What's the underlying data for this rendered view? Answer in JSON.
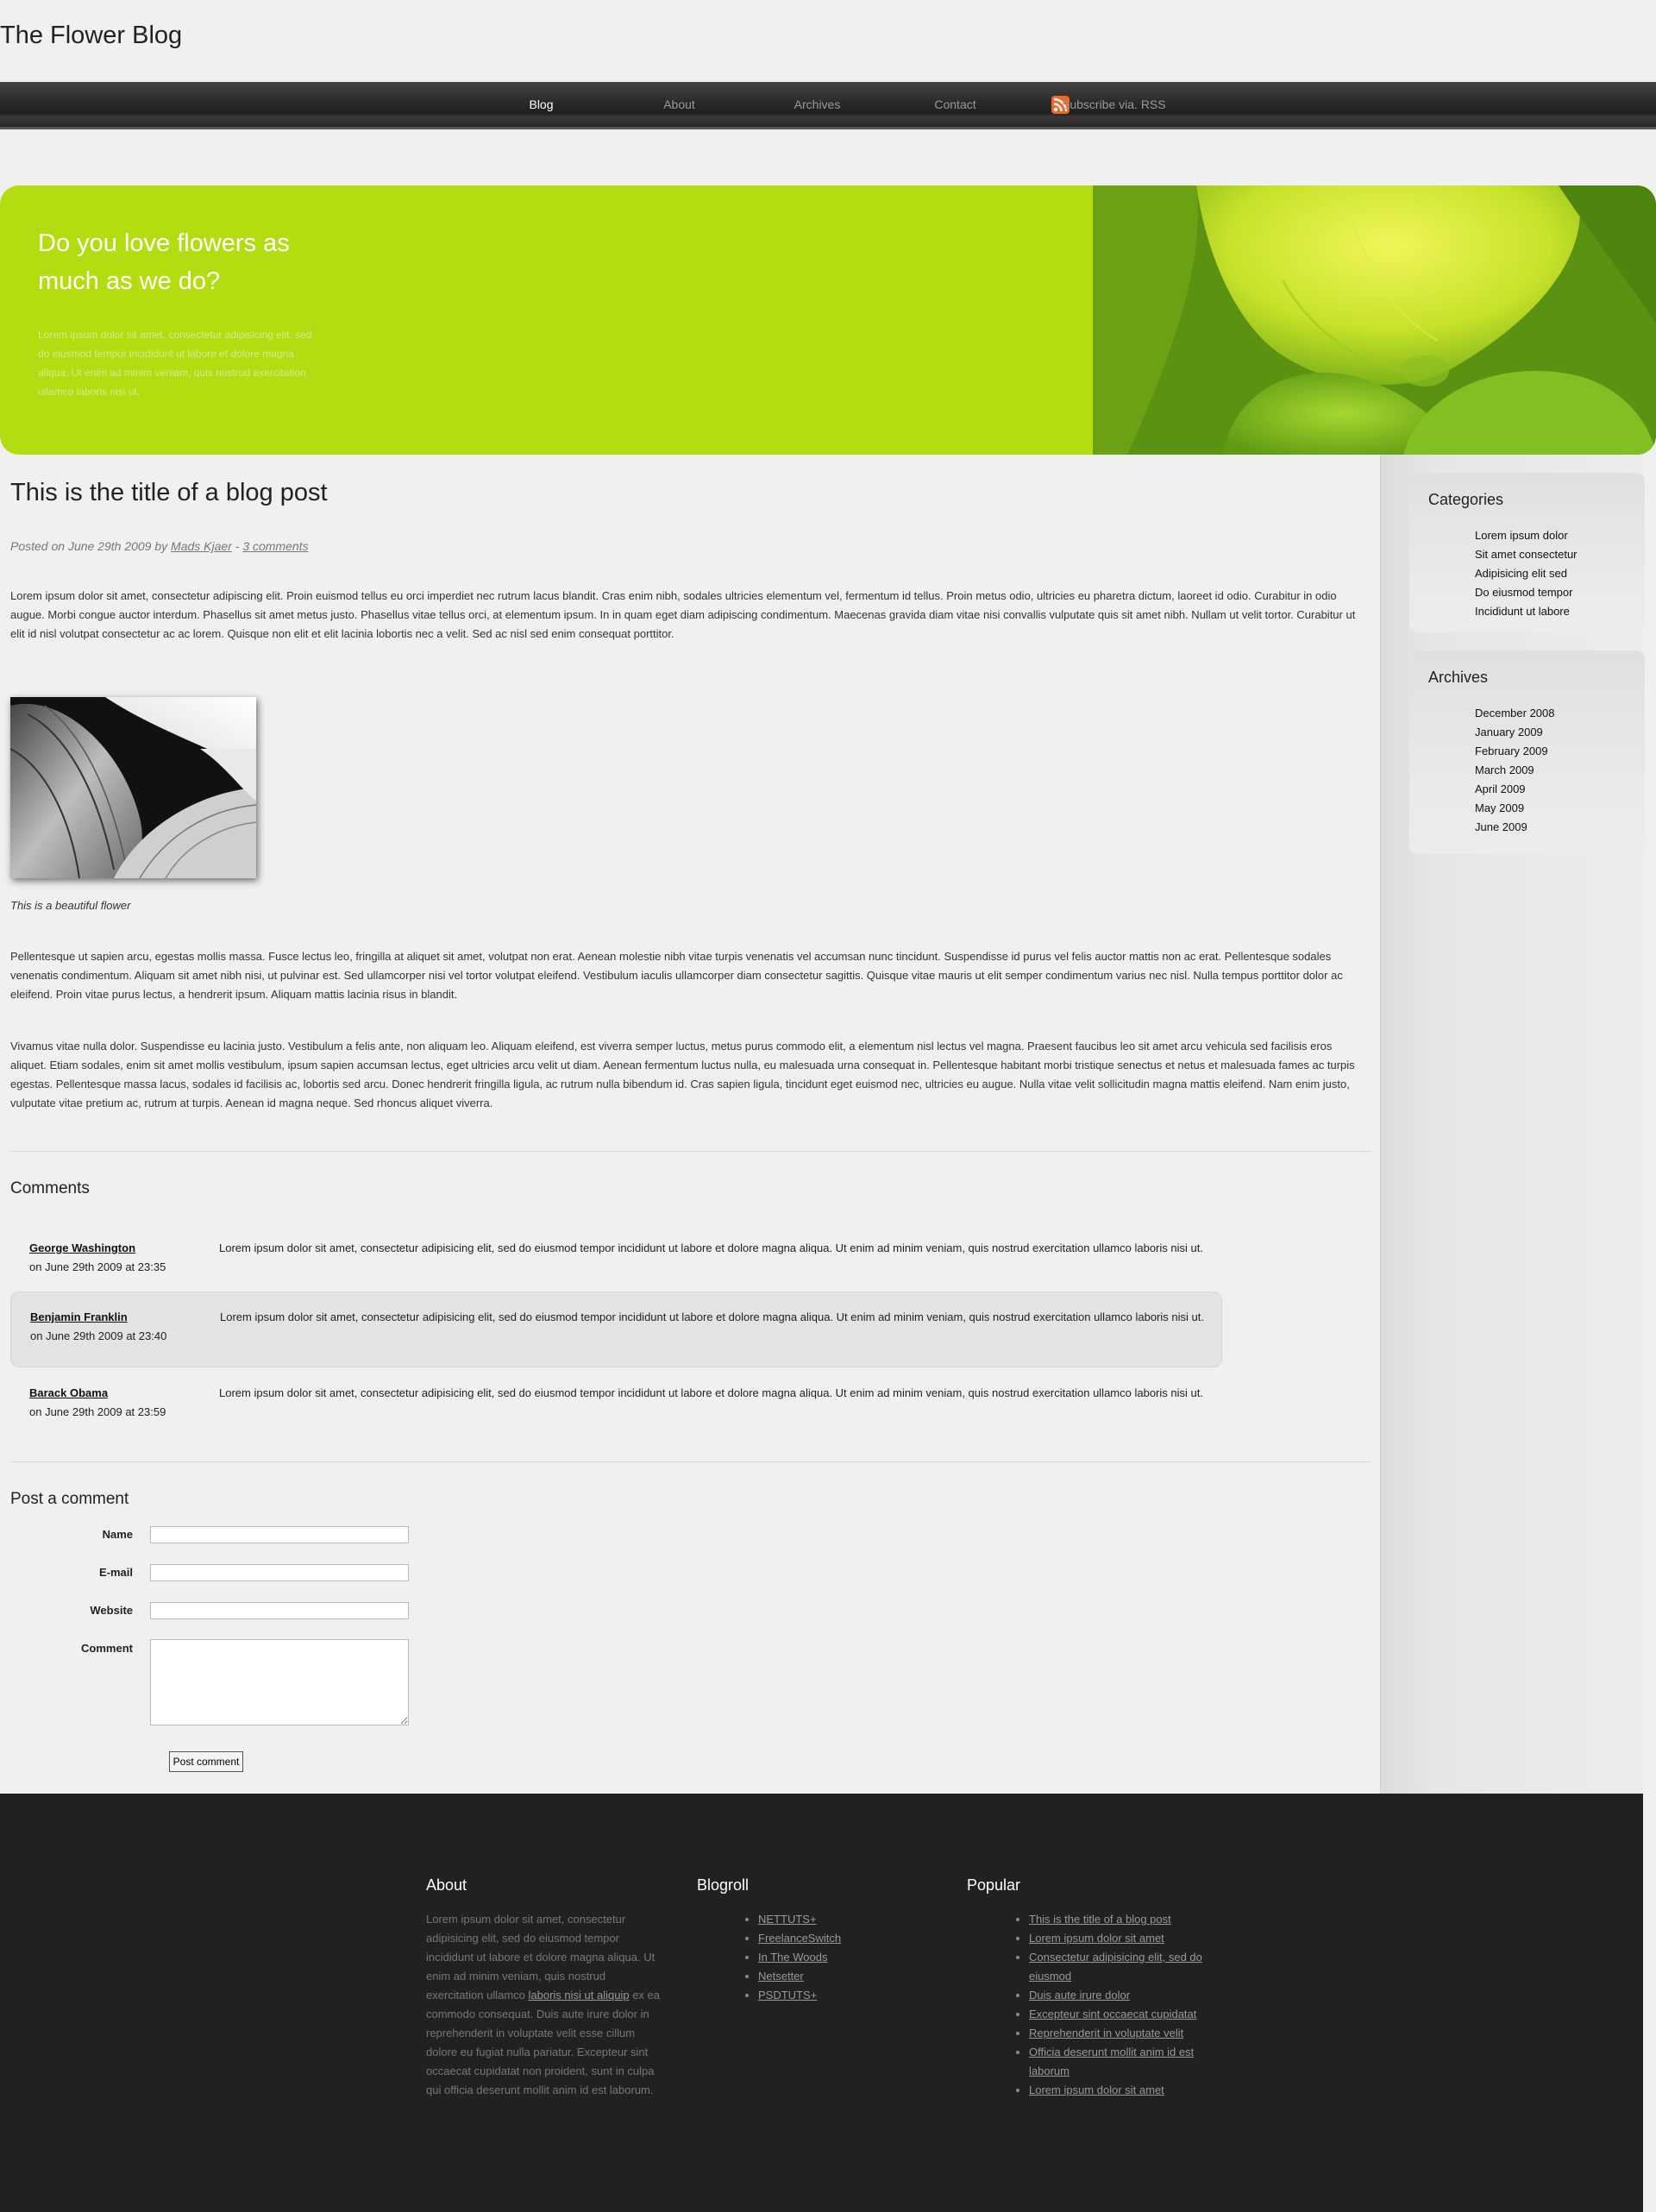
{
  "site": {
    "title": "The Flower Blog"
  },
  "nav": {
    "items": [
      {
        "label": "Blog",
        "active": true
      },
      {
        "label": "About"
      },
      {
        "label": "Archives"
      },
      {
        "label": "Contact"
      }
    ],
    "rss_label": "Subscribe via. RSS",
    "rss_icon": "rss-feed-icon"
  },
  "hero": {
    "title": "Do you love flowers as much as we do?",
    "text": "Lorem ipsum dolor sit amet, consectetur adipisicing elit, sed do eiusmod tempor incididunt ut labore et dolore magna aliqua. Ut enim ad minim veniam, quis nostrud exercitation ullamco laboris nisi ut."
  },
  "post": {
    "title": "This is the title of a blog post",
    "meta_prefix": "Posted on June 29th 2009 by ",
    "author": "Mads Kjaer",
    "meta_sep": " - ",
    "comments_link": "3 comments",
    "paragraphs": [
      "Lorem ipsum dolor sit amet, consectetur adipiscing elit. Proin euismod tellus eu orci imperdiet nec rutrum lacus blandit. Cras enim nibh, sodales ultricies elementum vel, fermentum id tellus. Proin metus odio, ultricies eu pharetra dictum, laoreet id odio. Curabitur in odio augue. Morbi congue auctor interdum. Phasellus sit amet metus justo. Phasellus vitae tellus orci, at elementum ipsum. In in quam eget diam adipiscing condimentum. Maecenas gravida diam vitae nisi convallis vulputate quis sit amet nibh. Nullam ut velit tortor. Curabitur ut elit id nisl volutpat consectetur ac ac lorem. Quisque non elit et elit lacinia lobortis nec a velit. Sed ac nisl sed enim consequat porttitor.",
      "Pellentesque ut sapien arcu, egestas mollis massa. Fusce lectus leo, fringilla at aliquet sit amet, volutpat non erat. Aenean molestie nibh vitae turpis venenatis vel accumsan nunc tincidunt. Suspendisse id purus vel felis auctor mattis non ac erat. Pellentesque sodales venenatis condimentum. Aliquam sit amet nibh nisi, ut pulvinar est. Sed ullamcorper nisi vel tortor volutpat eleifend. Vestibulum iaculis ullamcorper diam consectetur sagittis. Quisque vitae mauris ut elit semper condimentum varius nec nisl. Nulla tempus porttitor dolor ac eleifend. Proin vitae purus lectus, a hendrerit ipsum. Aliquam mattis lacinia risus in blandit.",
      "Vivamus vitae nulla dolor. Suspendisse eu lacinia justo. Vestibulum a felis ante, non aliquam leo. Aliquam eleifend, est viverra semper luctus, metus purus commodo elit, a elementum nisl lectus vel magna. Praesent faucibus leo sit amet arcu vehicula sed facilisis eros aliquet. Etiam sodales, enim sit amet mollis vestibulum, ipsum sapien accumsan lectus, eget ultricies arcu velit ut diam. Aenean fermentum luctus nulla, eu malesuada urna consequat in. Pellentesque habitant morbi tristique senectus et netus et malesuada fames ac turpis egestas. Pellentesque massa lacus, sodales id facilisis ac, lobortis sed arcu. Donec hendrerit fringilla ligula, ac rutrum nulla bibendum id. Cras sapien ligula, tincidunt eget euismod nec, ultricies eu augue. Nulla vitae velit sollicitudin magna mattis eleifend. Nam enim justo, vulputate vitae pretium ac, rutrum at turpis. Aenean id magna neque. Sed rhoncus aliquet viverra."
    ],
    "image_caption": "This is a beautiful flower"
  },
  "comments": {
    "title": "Comments",
    "items": [
      {
        "author": "George Washington",
        "date": "on June 29th 2009 at 23:35",
        "text": "Lorem ipsum dolor sit amet, consectetur adipisicing elit, sed do eiusmod tempor incididunt ut labore et dolore magna aliqua. Ut enim ad minim veniam, quis nostrud exercitation ullamco laboris nisi ut."
      },
      {
        "author": "Benjamin Franklin",
        "date": "on June 29th 2009 at 23:40",
        "text": "Lorem ipsum dolor sit amet, consectetur adipisicing elit, sed do eiusmod tempor incididunt ut labore et dolore magna aliqua. Ut enim ad minim veniam, quis nostrud exercitation ullamco laboris nisi ut."
      },
      {
        "author": "Barack Obama",
        "date": "on June 29th 2009 at 23:59",
        "text": "Lorem ipsum dolor sit amet, consectetur adipisicing elit, sed do eiusmod tempor incididunt ut labore et dolore magna aliqua. Ut enim ad minim veniam, quis nostrud exercitation ullamco laboris nisi ut."
      }
    ]
  },
  "form": {
    "title": "Post a comment",
    "name_label": "Name",
    "name_value": "",
    "email_label": "E-mail",
    "email_value": "",
    "website_label": "Website",
    "website_value": "",
    "comment_label": "Comment",
    "comment_value": "",
    "submit_label": "Post comment"
  },
  "sidebar": {
    "categories": {
      "title": "Categories",
      "items": [
        "Lorem ipsum dolor",
        "Sit amet consectetur",
        "Adipisicing elit sed",
        "Do eiusmod tempor",
        "Incididunt ut labore"
      ]
    },
    "archives": {
      "title": "Archives",
      "items": [
        "December 2008",
        "January 2009",
        "February 2009",
        "March 2009",
        "April 2009",
        "May 2009",
        "June 2009"
      ]
    }
  },
  "footer": {
    "about": {
      "title": "About",
      "text_before": "Lorem ipsum dolor sit amet, consectetur adipisicing elit, sed do eiusmod tempor incididunt ut labore et dolore magna aliqua. Ut enim ad minim veniam, quis nostrud exercitation ullamco ",
      "link": "laboris nisi ut aliquip",
      "text_after": " ex ea commodo consequat. Duis aute irure dolor in reprehenderit in voluptate velit esse cillum dolore eu fugiat nulla pariatur. Excepteur sint occaecat cupidatat non proident, sunt in culpa qui officia deserunt mollit anim id est laborum."
    },
    "blogroll": {
      "title": "Blogroll",
      "items": [
        "NETTUTS+",
        "FreelanceSwitch",
        "In The Woods",
        "Netsetter",
        "PSDTUTS+"
      ]
    },
    "popular": {
      "title": "Popular",
      "items": [
        "This is the title of a blog post",
        "Lorem ipsum dolor sit amet",
        "Consectetur adipisicing elit, sed do eiusmod",
        "Duis aute irure dolor",
        "Excepteur sint occaecat cupidatat",
        "Reprehenderit in voluptate velit",
        "Officia deserunt mollit anim id est laborum",
        "Lorem ipsum dolor sit amet"
      ]
    }
  },
  "colors": {
    "accent_green": "#b3dc11",
    "nav_bg": "#2a2a2a",
    "footer_bg": "#212121",
    "rss_orange": "#f26522"
  }
}
